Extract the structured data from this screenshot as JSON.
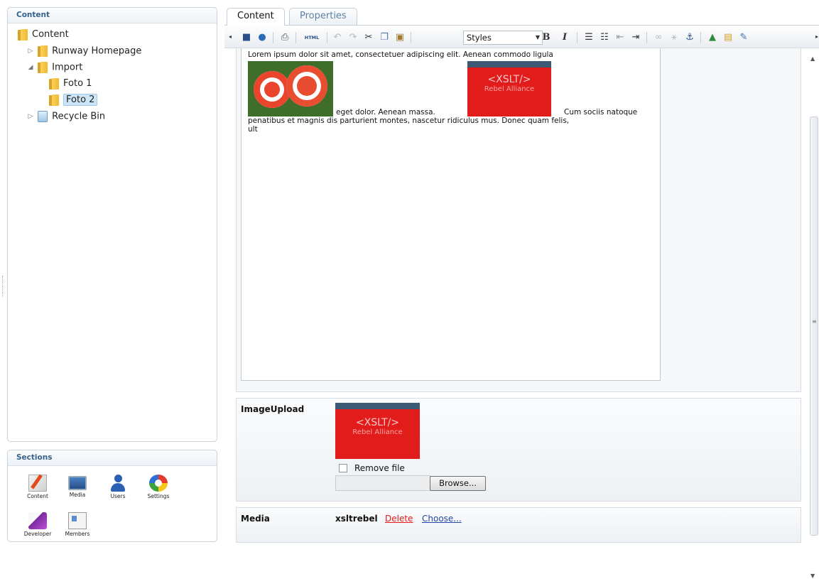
{
  "tree_panel": {
    "title": "Content",
    "nodes": [
      {
        "label": "Content"
      },
      {
        "label": "Runway Homepage",
        "expander": "▷"
      },
      {
        "label": "Import",
        "expander": "◢"
      },
      {
        "label": "Foto 1"
      },
      {
        "label": "Foto 2",
        "selected": true
      },
      {
        "label": "Recycle Bin",
        "expander": "▷"
      }
    ]
  },
  "sections_panel": {
    "title": "Sections",
    "items": [
      {
        "label": "Content",
        "icon": "content-icon"
      },
      {
        "label": "Media",
        "icon": "media-icon"
      },
      {
        "label": "Users",
        "icon": "users-icon"
      },
      {
        "label": "Settings",
        "icon": "settings-icon"
      },
      {
        "label": "Developer",
        "icon": "developer-icon"
      },
      {
        "label": "Members",
        "icon": "members-icon"
      }
    ]
  },
  "tabs": [
    {
      "label": "Content",
      "active": true
    },
    {
      "label": "Properties",
      "active": false
    }
  ],
  "toolbar": {
    "styles_value": "Styles",
    "html_label": "HTML",
    "bold_label": "B",
    "italic_label": "I"
  },
  "editor": {
    "line1": "Lorem ipsum dolor sit amet, consectetuer adipiscing elit. Aenean commodo ligula",
    "inline1": "eget dolor. Aenean massa.",
    "inline2": "Cum sociis natoque",
    "line3": "penatibus et magnis dis parturient montes, nascetur ridiculus mus. Donec quam felis,",
    "line4": "ult",
    "image_text_1": "<XSLT/>",
    "image_text_2": "Rebel Alliance"
  },
  "image_upload": {
    "label": "ImageUpload",
    "thumb_text_1": "<XSLT/>",
    "thumb_text_2": "Rebel Alliance",
    "remove_label": "Remove file",
    "browse_label": "Browse..."
  },
  "media": {
    "label": "Media",
    "value": "xsltrebel",
    "delete_label": "Delete",
    "choose_label": "Choose..."
  },
  "colors": {
    "accent": "#36618c",
    "link_red": "#e01818",
    "link_blue": "#2445a6"
  }
}
